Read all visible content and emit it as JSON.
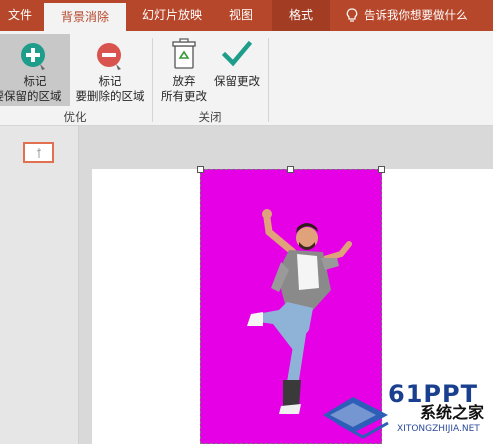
{
  "tabs": [
    {
      "label": "文件"
    },
    {
      "label": "背景消除"
    },
    {
      "label": "幻灯片放映"
    },
    {
      "label": "视图"
    },
    {
      "label": "格式"
    }
  ],
  "tell_me": "告诉我你想要做什么",
  "ribbon": {
    "mark_keep": {
      "line1": "标记",
      "line2": "要保留的区域"
    },
    "mark_remove": {
      "line1": "标记",
      "line2": "要删除的区域"
    },
    "discard": {
      "line1": "放弃",
      "line2": "所有更改"
    },
    "keep": {
      "line1": "保留更改"
    },
    "group_refine": "优化",
    "group_close": "关闭"
  },
  "watermark": {
    "brand": "61PPT",
    "url": "XITONGZHIJIA.NET",
    "name": "系统之家"
  },
  "colors": {
    "accent": "#b7472a",
    "removed_area": "#e600e6",
    "keep_icon": "#1e9e8a",
    "remove_icon": "#d9534f"
  }
}
